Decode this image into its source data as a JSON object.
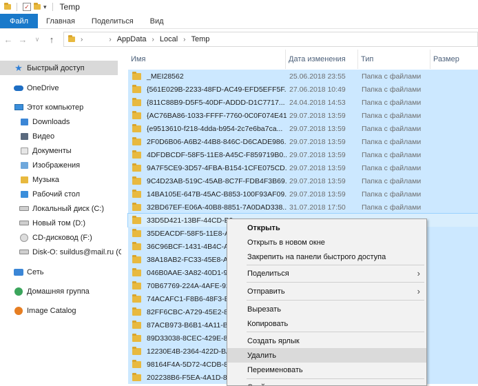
{
  "window": {
    "title": "Temp"
  },
  "ribbon": {
    "tabs": [
      "Файл",
      "Главная",
      "Поделиться",
      "Вид"
    ]
  },
  "address": {
    "crumbs": [
      "AppData",
      "Local",
      "Temp"
    ]
  },
  "navpane": {
    "items": [
      {
        "label": "Быстрый доступ",
        "icon": "star-icon"
      },
      {
        "label": "OneDrive",
        "icon": "cloud-icon"
      },
      {
        "label": "Этот компьютер",
        "icon": "computer-icon"
      },
      {
        "label": "Downloads",
        "icon": "download-folder-icon"
      },
      {
        "label": "Видео",
        "icon": "video-folder-icon"
      },
      {
        "label": "Документы",
        "icon": "documents-folder-icon"
      },
      {
        "label": "Изображения",
        "icon": "pictures-folder-icon"
      },
      {
        "label": "Музыка",
        "icon": "music-folder-icon"
      },
      {
        "label": "Рабочий стол",
        "icon": "desktop-folder-icon"
      },
      {
        "label": "Локальный диск (C:)",
        "icon": "drive-icon"
      },
      {
        "label": "Новый том (D:)",
        "icon": "drive-icon"
      },
      {
        "label": "CD-дисковод (F:)",
        "icon": "cd-drive-icon"
      },
      {
        "label": "Disk-O: suildus@mail.ru (O:",
        "icon": "network-drive-icon"
      },
      {
        "label": "Сеть",
        "icon": "network-icon"
      },
      {
        "label": "Домашняя группа",
        "icon": "homegroup-icon"
      },
      {
        "label": "Image Catalog",
        "icon": "image-catalog-icon"
      }
    ]
  },
  "columns": {
    "name": "Имя",
    "date": "Дата изменения",
    "type": "Тип",
    "size": "Размер"
  },
  "files": [
    {
      "name": "_MEI28562",
      "date": "25.06.2018 23:55",
      "type": "Папка с файлами"
    },
    {
      "name": "{561E029B-2233-48FD-AC49-EFD5EFF5F...",
      "date": "27.06.2018 10:49",
      "type": "Папка с файлами"
    },
    {
      "name": "{811C88B9-D5F5-40DF-ADDD-D1C7717...",
      "date": "24.04.2018 14:53",
      "type": "Папка с файлами"
    },
    {
      "name": "{AC76BA86-1033-FFFF-7760-0C0F074E41...",
      "date": "29.07.2018 13:59",
      "type": "Папка с файлами"
    },
    {
      "name": "{e9513610-f218-4dda-b954-2c7e6ba7ca...",
      "date": "29.07.2018 13:59",
      "type": "Папка с файлами"
    },
    {
      "name": "2F0D6B06-A6B2-44B8-846C-D6CADE986...",
      "date": "29.07.2018 13:59",
      "type": "Папка с файлами"
    },
    {
      "name": "4DFDBCDF-58F5-11E8-A45C-F859719B0...",
      "date": "29.07.2018 13:59",
      "type": "Папка с файлами"
    },
    {
      "name": "9A7F5CE9-3D57-4FBA-B154-1CFE075CD...",
      "date": "29.07.2018 13:59",
      "type": "Папка с файлами"
    },
    {
      "name": "9C4D23AB-519C-45AB-8C7F-FDB4F3B69...",
      "date": "29.07.2018 13:59",
      "type": "Папка с файлами"
    },
    {
      "name": "14BA105E-647B-45AC-B853-100F93AF09...",
      "date": "29.07.2018 13:59",
      "type": "Папка с файлами"
    },
    {
      "name": "32BD67EF-E06A-40B8-8851-7A0DAD338...",
      "date": "31.07.2018 17:50",
      "type": "Папка с файлами"
    },
    {
      "name": "33D5D421-13BF-44CD-B9",
      "date": "",
      "type": ""
    },
    {
      "name": "35DEACDF-58F5-11E8-A4",
      "date": "",
      "type": ""
    },
    {
      "name": "36C96BCF-1431-4B4C-AC",
      "date": "",
      "type": ""
    },
    {
      "name": "38A18AB2-FC33-45E8-AF",
      "date": "",
      "type": ""
    },
    {
      "name": "046B0AAE-3A82-40D1-92",
      "date": "",
      "type": ""
    },
    {
      "name": "70B67769-224A-4AFE-92E",
      "date": "",
      "type": ""
    },
    {
      "name": "74ACAFC1-F8B6-48F3-B50",
      "date": "",
      "type": ""
    },
    {
      "name": "82FF6CBC-A729-45E2-8A0",
      "date": "",
      "type": ""
    },
    {
      "name": "87ACB973-B6B1-4A11-BD",
      "date": "",
      "type": ""
    },
    {
      "name": "89D33038-8CEC-429E-8B",
      "date": "",
      "type": ""
    },
    {
      "name": "12230E4B-2364-422D-BA",
      "date": "",
      "type": ""
    },
    {
      "name": "98164F4A-5D72-4CDB-8C",
      "date": "",
      "type": ""
    },
    {
      "name": "202238B6-F5EA-4A1D-85",
      "date": "",
      "type": ""
    }
  ],
  "context_menu": {
    "items": [
      {
        "label": "Открыть",
        "bold": true
      },
      {
        "label": "Открыть в новом окне"
      },
      {
        "label": "Закрепить на панели быстрого доступа"
      },
      {
        "label": "Поделиться",
        "submenu": true
      },
      {
        "label": "Отправить",
        "submenu": true
      },
      {
        "label": "Вырезать"
      },
      {
        "label": "Копировать"
      },
      {
        "label": "Создать ярлык"
      },
      {
        "label": "Удалить",
        "highlighted": true
      },
      {
        "label": "Переименовать"
      },
      {
        "label": "Свойства"
      }
    ]
  },
  "colors": {
    "selection": "#cce8ff",
    "file_tab": "#1979ca",
    "folder": "#e8b93f"
  }
}
